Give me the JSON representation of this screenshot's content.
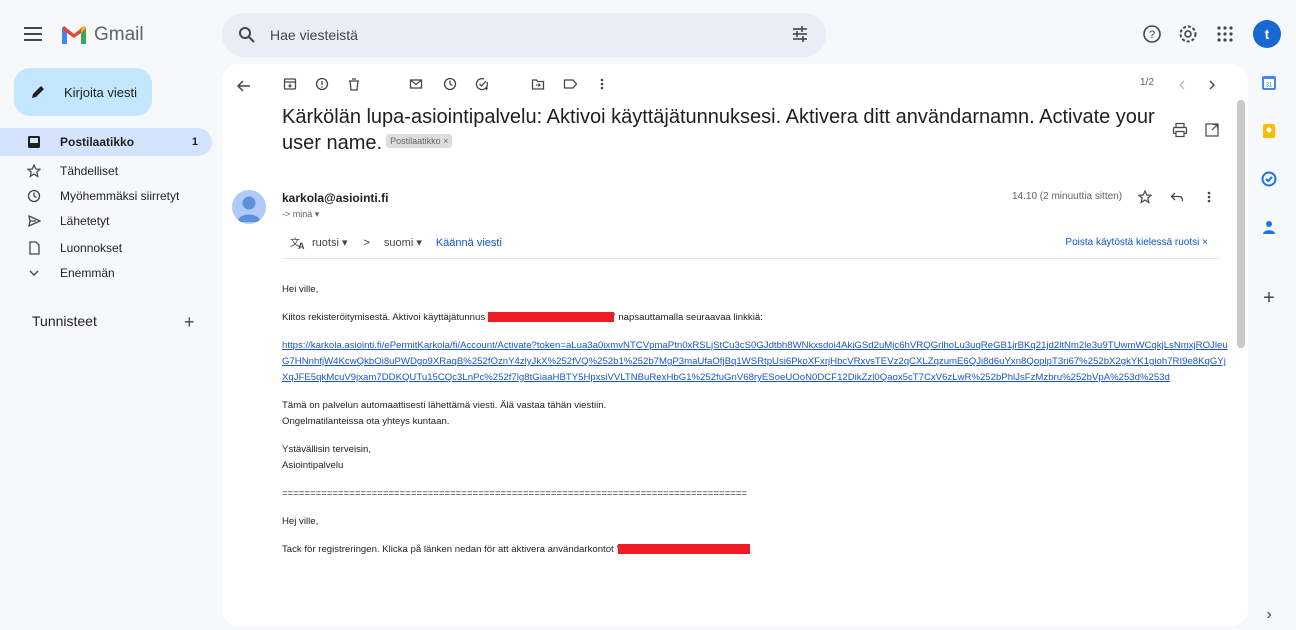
{
  "app": {
    "name": "Gmail",
    "brand_colors": {
      "red": "#ea4335",
      "blue": "#4285f4",
      "green": "#34a853",
      "yellow": "#fbbc04"
    }
  },
  "search": {
    "placeholder": "Hae viesteistä"
  },
  "user": {
    "initial": "t"
  },
  "compose": {
    "label": "Kirjoita viesti"
  },
  "sidebar": {
    "items": [
      {
        "label": "Postilaatikko",
        "count": "1",
        "icon": "inbox-icon"
      },
      {
        "label": "Tähdelliset",
        "icon": "star-icon"
      },
      {
        "label": "Myöhemmäksi siirretyt",
        "icon": "clock-icon"
      },
      {
        "label": "Lähetetyt",
        "icon": "send-icon"
      },
      {
        "label": "Luonnokset",
        "icon": "draft-icon"
      },
      {
        "label": "Enemmän",
        "icon": "chevron-down-icon"
      }
    ],
    "labels_heading": "Tunnisteet",
    "labels_add": "+"
  },
  "toolbar": {
    "pager": "1/2"
  },
  "message": {
    "subject": "Kärkölän lupa-asiointipalvelu: Aktivoi käyttäjätunnuksesi. Aktivera ditt användarnamn. Activate your user name.",
    "label_chip": "Postilaatikko ×",
    "sender": "karkola@asiointi.fi",
    "to": "-> minä ▾",
    "time": "14.10 (2 minuuttia sitten)",
    "translate": {
      "from": "ruotsi ▾",
      "arrow": ">",
      "to": "suomi ▾",
      "action": "Käännä viesti",
      "disable": "Poista käytöstä kielessä ruotsi ×"
    },
    "body": {
      "greeting_fi": "Hei ville,",
      "thanks_fi_before": "Kiitos rekisteröitymisestä. Aktivoi käyttäjätunnus",
      "thanks_fi_after": "' napsauttamalla seuraavaa linkkiä:",
      "link": "https://karkola.asiointi.fi/ePermitKarkola/fi/Account/Activate?token=aLua3a0ixmvNTCVpmaPtn0xRSLjStCu3cS0GJdtbh8WNkxsdoi4AkiGSd2uMjc6hVRQGrlhoLu3uqReGB1jrBKq21jd2ltNm2le3u9TUwmWCqkjLsNmxjROJleuG7HNnhfjW4KcwQkbOi8uPWDgo9XRaqB%252fOznY4zlyJkX%252fVQ%252b1%252b7MgP3maUfaOfjBq1WSRtpUsi6PkoXFxrjHbcVRxvsTEVz2qCXLZqzumE6QJi8d6uYxn8QoplpT3ri67%252bX2gkYK1gioh7RI9e8KqGYjXqJFE5qkMcuV9jxam7DDKQUTu15CQc3LnPc%252f7lg8tGiaaHBTY5HpxsiVVLTNBuRexHbG1%252fuGnV68ryESoeUOoN0DCF12DikZzl0Qaox5cT7CxV6zLwR%252bPhlJsFzMzbru%252bVpA%253d%253d",
      "auto_fi_1": "Tämä on palvelun automaattisesti lähettämä viesti. Älä vastaa tähän viestiin.",
      "auto_fi_2": "Ongelmatilanteissa ota yhteys kuntaan.",
      "regards_fi_1": "Ystävällisin terveisin,",
      "regards_fi_2": "Asiointipalvelu",
      "separator": "===================================================================================",
      "greeting_sv": "Hej ville,",
      "thanks_sv_before": "Tack för registreringen. Klicka på länken nedan för att aktivera användarkontot '"
    }
  },
  "rail": {
    "add": "+",
    "expand": "›"
  }
}
